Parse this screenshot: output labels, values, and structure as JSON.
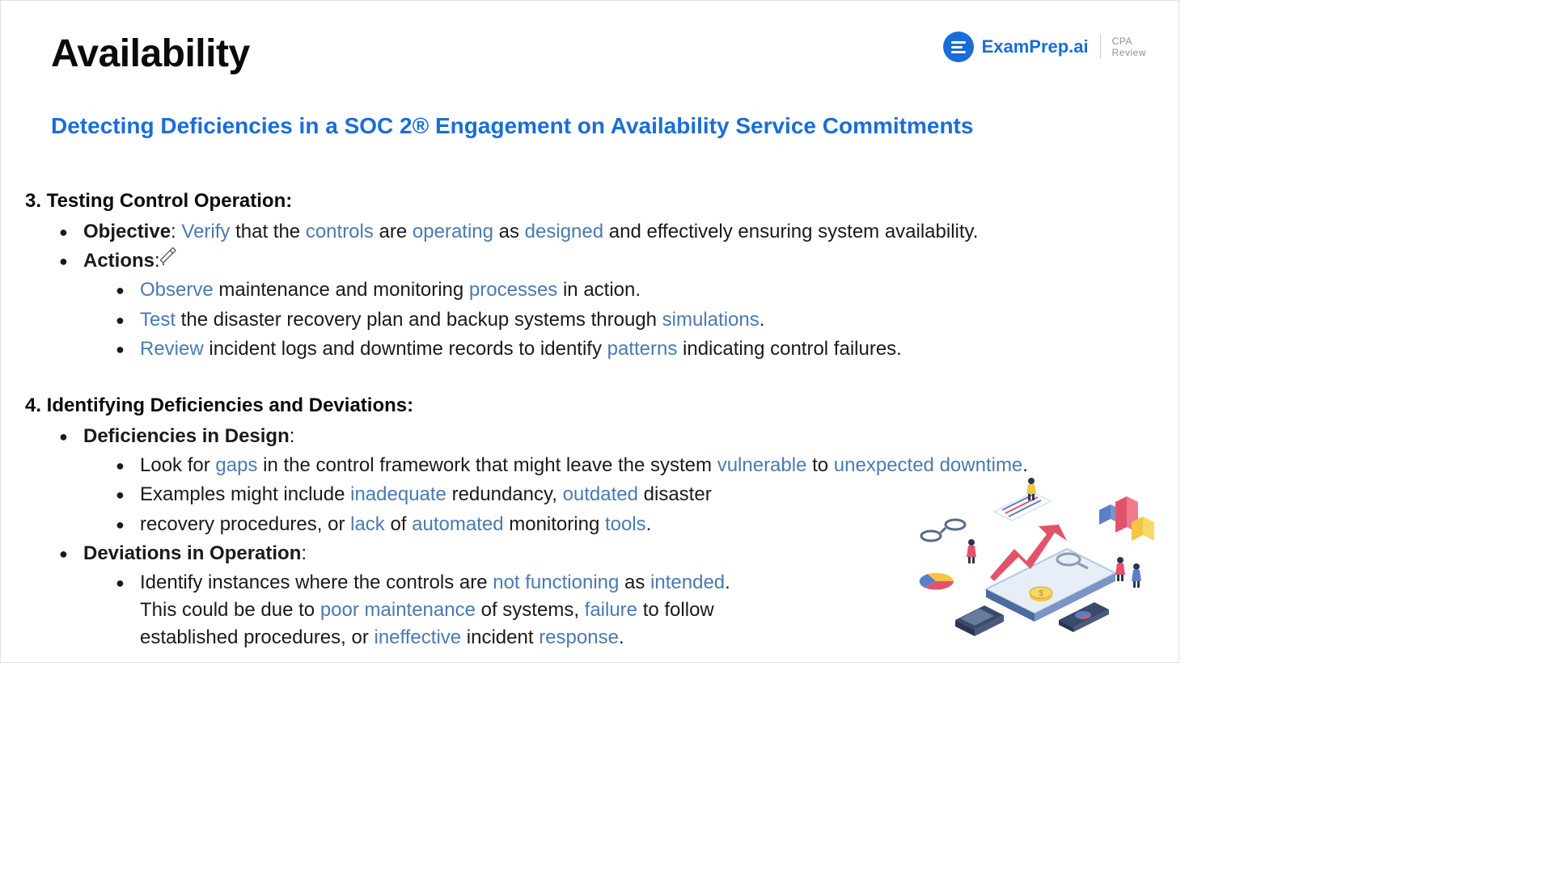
{
  "header": {
    "title": "Availability",
    "brand": "ExamPrep.ai",
    "cpa_line1": "CPA",
    "cpa_line2": "Review"
  },
  "subtitle": "Detecting Deficiencies in a SOC 2® Engagement on Availability Service Commitments",
  "s3": {
    "head": "3. Testing Control Operation:",
    "obj_label": "Objective",
    "obj_colon": ": ",
    "obj_verify": "Verify",
    "obj_t1": " that the ",
    "obj_controls": "controls",
    "obj_t2": " are ",
    "obj_operating": "operating",
    "obj_t3": " as ",
    "obj_designed": "designed",
    "obj_t4": " and effectively ensuring system availability.",
    "act_label": "Actions",
    "act_colon": ":",
    "a1_observe": "Observe",
    "a1_t1": " maintenance and monitoring ",
    "a1_processes": "processes",
    "a1_t2": " in action.",
    "a2_test": "Test",
    "a2_t1": " the disaster recovery plan and backup systems through ",
    "a2_sim": "simulations",
    "a2_t2": ".",
    "a3_review": "Review",
    "a3_t1": " incident logs and downtime records to identify ",
    "a3_patterns": "patterns",
    "a3_t2": " indicating control failures."
  },
  "s4": {
    "head": "4. Identifying Deficiencies and Deviations:",
    "def_label": "Deficiencies in Design",
    "def_colon": ":",
    "d1_t1": "Look for ",
    "d1_gaps": "gaps",
    "d1_t2": " in the control framework that might leave the system ",
    "d1_vuln": "vulnerable",
    "d1_t3": " to ",
    "d1_unex": "unexpected downtime",
    "d1_t4": ".",
    "d2_t1": "Examples might include ",
    "d2_inad": "inadequate",
    "d2_t2": " redundancy, ",
    "d2_outd": "outdated",
    "d2_t3": " disaster",
    "d3_t1": "recovery procedures, or ",
    "d3_lack": "lack",
    "d3_t2": " of ",
    "d3_auto": "automated",
    "d3_t3": " monitoring ",
    "d3_tools": "tools",
    "d3_t4": ".",
    "dev_label": "Deviations in Operation",
    "dev_colon": ":",
    "v1_t1": "Identify instances where the controls are ",
    "v1_notf": "not functioning",
    "v1_t2": " as ",
    "v1_intd": "intended",
    "v1_t3": ". This could be due to ",
    "v1_poor": "poor maintenance",
    "v1_t4": " of systems, ",
    "v1_fail": "failure",
    "v1_t5": " to follow established procedures, or ",
    "v1_inef": "ineffective",
    "v1_t6": " incident ",
    "v1_resp": "response",
    "v1_t7": "."
  }
}
